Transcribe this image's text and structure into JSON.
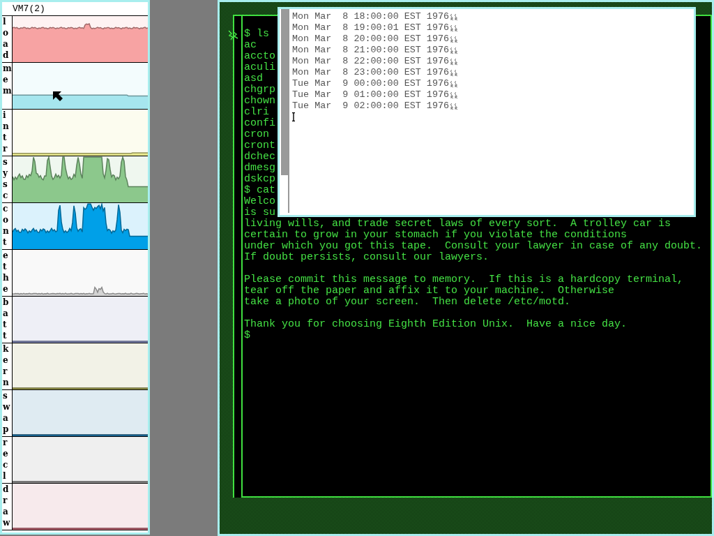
{
  "panel": {
    "title": "VM7(2)",
    "graphs": [
      {
        "label": "load",
        "color": "#f7a3a3"
      },
      {
        "label": "mem",
        "color": "#a6e6ee"
      },
      {
        "label": "intr",
        "color": "#e6e68c"
      },
      {
        "label": "sysc",
        "color": "#8cc88c"
      },
      {
        "label": "cont",
        "color": "#00a0e8"
      },
      {
        "label": "ethe",
        "color": "#d4d4d4"
      },
      {
        "label": "batt",
        "color": "#8890c0"
      },
      {
        "label": "kern",
        "color": "#a0a050"
      },
      {
        "label": "swap",
        "color": "#1a6ea0"
      },
      {
        "label": "recl",
        "color": "#909090"
      },
      {
        "label": "draw",
        "color": "#c86878"
      }
    ]
  },
  "terminal": {
    "blocks": [
      [
        "$ ls",
        "ac",
        "accto",
        "aculi",
        "asd",
        "chgrp",
        "chown",
        "clri",
        "confi",
        "cron",
        "cront",
        "dchec",
        "dmesg",
        "dskcp",
        "$ cat",
        "Welco",
        "is su",
        "living wills, and trade secret laws of every sort.  A trolley car is",
        "certain to grow in your stomach if you violate the conditions",
        "under which you got this tape.  Consult your lawyer in case of any doubt.",
        "If doubt persists, consult our lawyers."
      ],
      [
        "Please commit this message to memory.  If this is a hardcopy terminal,",
        "tear off the paper and affix it to your machine.  Otherwise",
        "take a photo of your screen.  Then delete /etc/motd."
      ],
      [
        "Thank you for choosing Eighth Edition Unix.  Have a nice day.",
        "$"
      ]
    ]
  },
  "popup": {
    "lines": [
      "Mon Mar  8 18:00:00 EST 1976",
      "Mon Mar  8 19:00:01 EST 1976",
      "Mon Mar  8 20:00:00 EST 1976",
      "Mon Mar  8 21:00:00 EST 1976",
      "Mon Mar  8 22:00:00 EST 1976",
      "Mon Mar  8 23:00:00 EST 1976",
      "Tue Mar  9 00:00:00 EST 1976",
      "Tue Mar  9 01:00:00 EST 1976",
      "Tue Mar  9 02:00:00 EST 1976"
    ]
  }
}
